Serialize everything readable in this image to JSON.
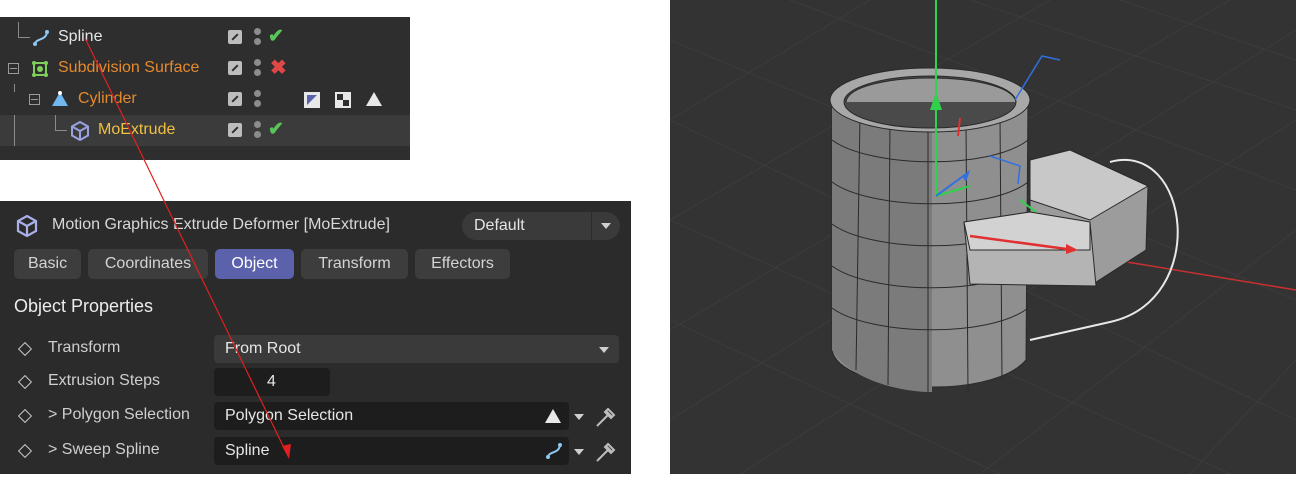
{
  "object_manager": {
    "items": [
      {
        "name": "Spline",
        "color": "#e6e6e6",
        "status": "check"
      },
      {
        "name": "Subdivision Surface",
        "color": "#e58a2c",
        "status": "cross"
      },
      {
        "name": "Cylinder",
        "color": "#e58a2c",
        "status": "none"
      },
      {
        "name": "MoExtrude",
        "color": "#f0c040",
        "status": "check"
      }
    ],
    "cylinder_tags": [
      "phong-tag-icon",
      "texture-tag-icon",
      "polygon-selection-tag-icon"
    ]
  },
  "attribute_manager": {
    "title": "Motion Graphics Extrude Deformer [MoExtrude]",
    "preset": "Default",
    "tabs": [
      {
        "label": "Basic",
        "active": false
      },
      {
        "label": "Coordinates",
        "active": false
      },
      {
        "label": "Object",
        "active": true
      },
      {
        "label": "Transform",
        "active": false
      },
      {
        "label": "Effectors",
        "active": false
      }
    ],
    "section_title": "Object Properties",
    "properties": [
      {
        "label": "Transform",
        "value": "From Root"
      },
      {
        "label": "Extrusion Steps",
        "value": "4"
      },
      {
        "label": "> Polygon Selection",
        "value": "Polygon Selection"
      },
      {
        "label": "> Sweep Spline",
        "value": "Spline"
      }
    ]
  },
  "colors": {
    "accent_tab": "#5c61ab",
    "annotation_arrow": "#e02020",
    "axis_y": "#2fd24a",
    "axis_x": "#e03030",
    "axis_z": "#3070e0"
  }
}
